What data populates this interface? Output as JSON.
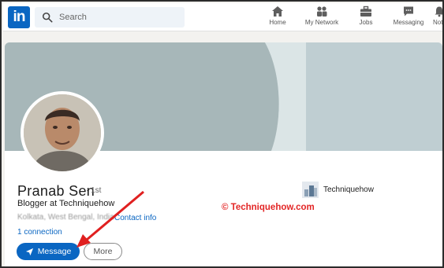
{
  "nav": {
    "logo": "in",
    "search_placeholder": "Search",
    "items": [
      {
        "label": "Home",
        "icon": "home-icon"
      },
      {
        "label": "My Network",
        "icon": "network-icon"
      },
      {
        "label": "Jobs",
        "icon": "briefcase-icon"
      },
      {
        "label": "Messaging",
        "icon": "messaging-icon"
      },
      {
        "label": "Not",
        "icon": "bell-icon"
      }
    ]
  },
  "profile": {
    "name": "Pranab Sen",
    "degree": "· 1st",
    "headline": "Blogger at Techniquehow",
    "location": "Kolkata, West Bengal, India",
    "contact_info": "Contact info",
    "connections": "1 connection",
    "message_button": "Message",
    "more_button": "More",
    "company": "Techniquehow"
  },
  "watermark": "© Techniquehow.com",
  "colors": {
    "brand_blue": "#0a66c2",
    "banner_gray": "#a8b9bc",
    "watermark_red": "#e32626",
    "arrow_red": "#e02020"
  }
}
